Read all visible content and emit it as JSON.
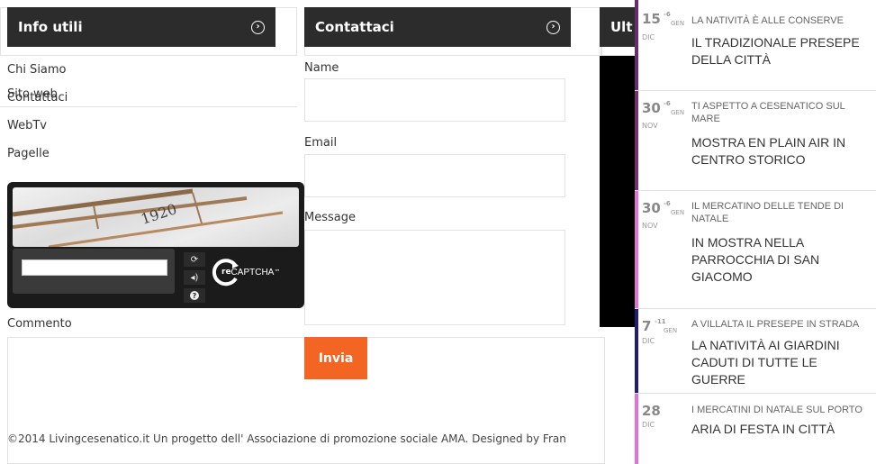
{
  "info": {
    "title": "Info utili",
    "links": [
      "Chi Siamo",
      "Sito web",
      "Contattaci",
      "WebTv",
      "Pagelle"
    ]
  },
  "contact": {
    "title": "Contattaci",
    "name_label": "Name",
    "email_label": "Email",
    "message_label": "Message",
    "submit_label": "Invia"
  },
  "third_box": {
    "title": "Ult"
  },
  "captcha": {
    "image_text": "1920",
    "brand": "CAPTCHA",
    "brand_prefix": "re",
    "trademark": "™"
  },
  "comment": {
    "label": "Commento"
  },
  "footer": {
    "text": "©2014 Livingcesenatico.it Un progetto dell' Associazione di promozione sociale AMA. Designed by Fran"
  },
  "events": [
    {
      "day": "15",
      "sup_num": "6",
      "sup_mon": "GEN",
      "month": "DIC",
      "subtitle": "LA NATIVITÀ È ALLE CONSERVE",
      "title": "IL TRADIZIONALE PRESEPE DELLA CITTÀ",
      "color": "#6a2a72"
    },
    {
      "day": "30",
      "sup_num": "6",
      "sup_mon": "GEN",
      "month": "NOV",
      "subtitle": "TI ASPETTO A CESENATICO SUL MARE",
      "title": "MOSTRA EN PLAIN AIR IN CENTRO STORICO",
      "color": "#7a2e6e"
    },
    {
      "day": "30",
      "sup_num": "6",
      "sup_mon": "GEN",
      "month": "NOV",
      "subtitle": "IL MERCATINO DELLE TENDE DI NATALE",
      "title": "IN MOSTRA NELLA PARROCCHIA DI SAN GIACOMO",
      "color": "#e56fd4"
    },
    {
      "day": "7",
      "sup_num": "11",
      "sup_mon": "GEN",
      "month": "DIC",
      "subtitle": "A VILLALTA IL PRESEPE IN STRADA",
      "title": "LA NATIVITÀ AI GIARDINI CADUTI DI TUTTE LE GUERRE",
      "color": "#1e1e7a"
    },
    {
      "day": "28",
      "sup_num": "",
      "sup_mon": "",
      "month": "DIC",
      "subtitle": "I MERCATINI DI NATALE SUL PORTO",
      "title": "ARIA DI FESTA IN CITTÀ",
      "color": "#e56fd4"
    }
  ]
}
